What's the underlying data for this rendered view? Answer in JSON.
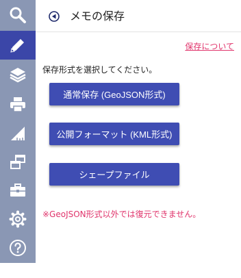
{
  "header": {
    "title": "メモの保存"
  },
  "help_link": "保存について",
  "instruction": "保存形式を選択してください。",
  "buttons": {
    "geojson": "通常保存 (GeoJSON形式)",
    "kml": "公開フォーマット (KML形式)",
    "shapefile": "シェープファイル"
  },
  "note": "※GeoJSON形式以外では復元できません。",
  "sidebar": {
    "items": [
      {
        "icon": "search-icon"
      },
      {
        "icon": "pencil-icon",
        "active": true
      },
      {
        "icon": "layers-icon"
      },
      {
        "icon": "printer-icon"
      },
      {
        "icon": "ruler-icon"
      },
      {
        "icon": "windows-icon"
      },
      {
        "icon": "toolbox-icon"
      },
      {
        "icon": "gear-icon"
      },
      {
        "icon": "help-icon"
      }
    ]
  },
  "colors": {
    "sidebar": "#8a97b4",
    "active": "#3b46a8",
    "button": "#3f4db3",
    "accent": "#e0336b"
  }
}
